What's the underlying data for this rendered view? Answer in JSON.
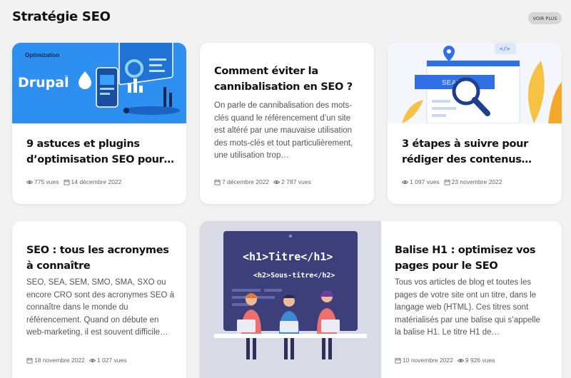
{
  "section": {
    "title": "Stratégie SEO",
    "more_label": "VOIR PLUS"
  },
  "cards": [
    {
      "title": "9 astuces et plugins d’optimisation SEO pour…",
      "views": "775 vues",
      "date": "14 décembre 2022",
      "thumb_label": "Optimization",
      "thumb_brand": "Drupal",
      "thumb_tm": "™"
    },
    {
      "title": "Comment éviter la cannibalisation en SEO ?",
      "excerpt": "On parle de cannibalisation des mots-clés quand le référencement d’un site est altéré par une mauvaise utilisation des mots-clés et tout particulièrement, une utilisation trop…",
      "date": "7 décembre 2022",
      "views": "2 787 vues"
    },
    {
      "title": "3 étapes à suivre pour rédiger des contenus…",
      "views": "1 097 vues",
      "date": "23 novembre 2022",
      "thumb_search": "SEARCH",
      "thumb_code": "</>"
    },
    {
      "title": "SEO : tous les acronymes à connaître",
      "excerpt": "SEO, SEA, SEM, SMO, SMA, SXO ou encore CRO sont des acronymes SEO à connaître dans le monde du référencement. Quand on débute en web-marketing, il est souvent difficile…",
      "date": "18 novembre 2022",
      "views": "1 027 vues"
    },
    {
      "title": "Balise H1 : optimisez vos pages pour le SEO",
      "excerpt": "Tous vos articles de blog et toutes les pages de votre site ont un titre, dans le langage web (HTML). Ces titres sont matérialisés par une balise qui s’appelle la balise H1. Le titre H1 de…",
      "date": "10 novembre 2022",
      "views": "9 926 vues",
      "thumb_h1": "<h1>Titre</h1>",
      "thumb_h2": "<h2>Sous-titre</h2>"
    }
  ],
  "colors": {
    "drupal_blue": "#2d8ff0",
    "search_blue": "#2f6fe8",
    "code_screen": "#3d3f7a",
    "illustration_bg": "#d8dbe6"
  }
}
